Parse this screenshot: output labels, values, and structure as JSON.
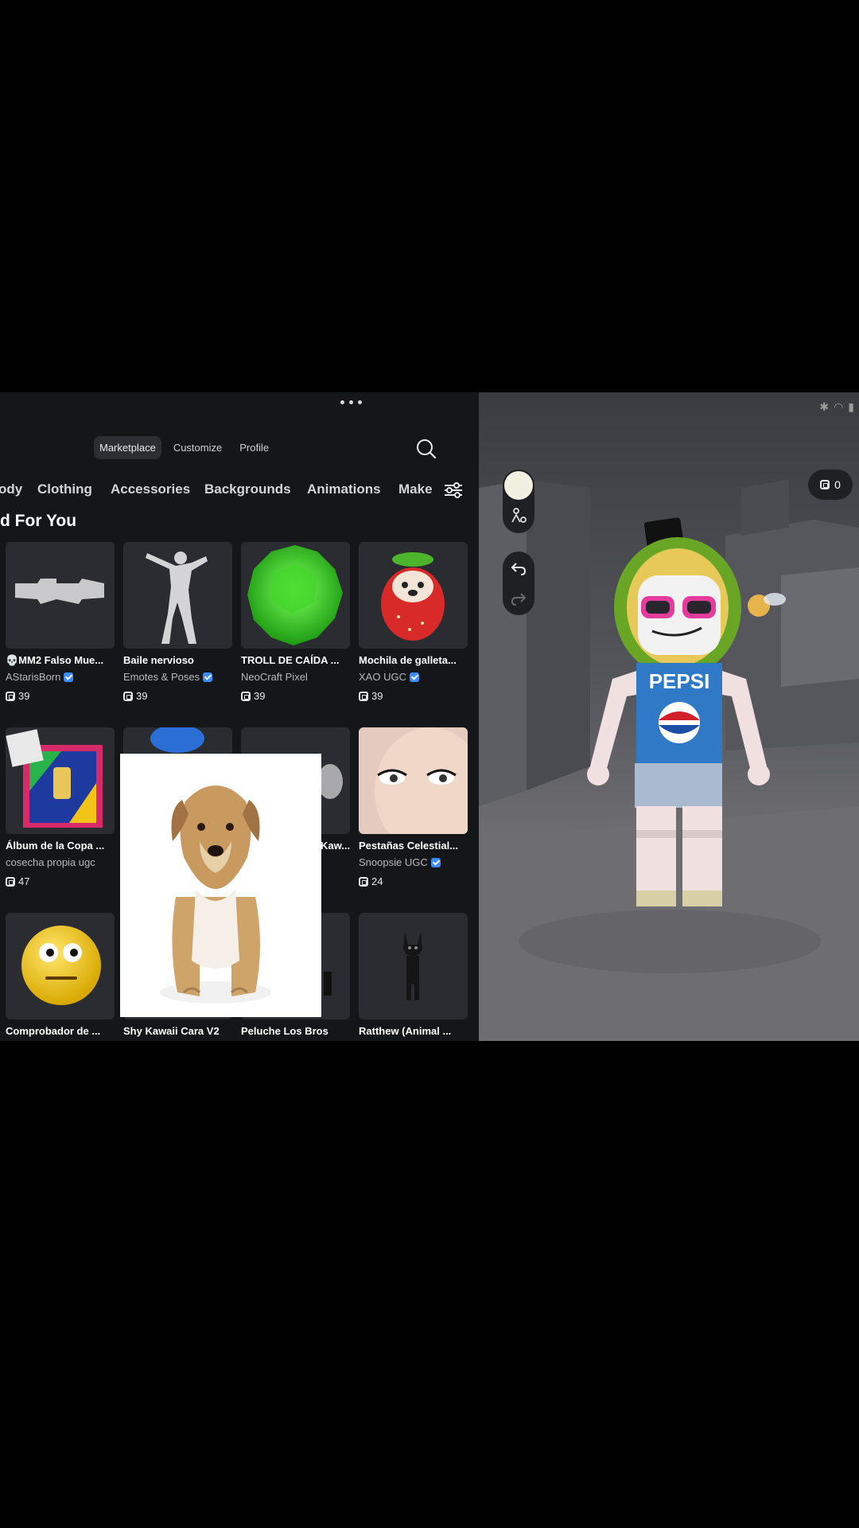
{
  "nav": {
    "tabs": [
      "Marketplace",
      "Customize",
      "Profile"
    ],
    "active": "Marketplace"
  },
  "categories": [
    "ody",
    "Clothing",
    "Accessories",
    "Backgrounds",
    "Animations",
    "Make"
  ],
  "section_title": "d For You",
  "items": [
    {
      "name": "💀MM2 Falso Mue...",
      "creator": "AStarisBorn",
      "verified": true,
      "price": "39"
    },
    {
      "name": "Baile nervioso",
      "creator": "Emotes & Poses",
      "verified": true,
      "price": "39"
    },
    {
      "name": "TROLL DE CAÍDA ...",
      "creator": "NeoCraft Pixel",
      "verified": false,
      "price": "39"
    },
    {
      "name": "Mochila de galleta...",
      "creator": "XAO UGC",
      "verified": true,
      "price": "39"
    },
    {
      "name": "Álbum de la Copa ...",
      "creator": "cosecha propia ugc",
      "verified": false,
      "price": "47"
    },
    {
      "name": "",
      "creator": "",
      "verified": false,
      "price": ""
    },
    {
      "name": "Kaw...",
      "creator": "",
      "verified": false,
      "price": ""
    },
    {
      "name": "Pestañas Celestial...",
      "creator": "Snoopsie UGC",
      "verified": true,
      "price": "24"
    },
    {
      "name": "Comprobador de ...",
      "creator": "",
      "verified": false,
      "price": ""
    },
    {
      "name": "Shy Kawaii Cara V2",
      "creator": "",
      "verified": false,
      "price": ""
    },
    {
      "name": "Peluche Los Bros",
      "creator": "",
      "verified": false,
      "price": ""
    },
    {
      "name": "Ratthew (Animal ...",
      "creator": "",
      "verified": false,
      "price": ""
    }
  ],
  "balance": "0",
  "avatar_shirt_text": "PEPSI",
  "colors": {
    "panel_bg": "#15161a",
    "card_bg": "#2b2c31",
    "verified": "#3b8cff"
  }
}
